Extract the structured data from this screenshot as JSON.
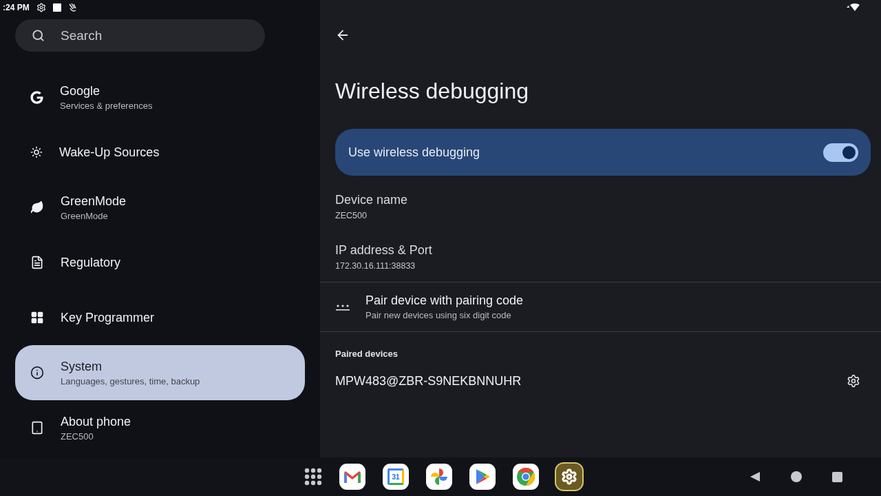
{
  "status_bar": {
    "time": ":24 PM"
  },
  "sidebar": {
    "search": {
      "placeholder": "Search"
    },
    "items": [
      {
        "kind": "google",
        "title": "Google",
        "subtitle": "Services & preferences",
        "selected": false
      },
      {
        "kind": "wake",
        "title": "Wake-Up Sources",
        "selected": false
      },
      {
        "kind": "leaf",
        "title": "GreenMode",
        "subtitle": "GreenMode",
        "selected": false
      },
      {
        "kind": "document",
        "title": "Regulatory",
        "selected": false
      },
      {
        "kind": "grid",
        "title": "Key Programmer",
        "selected": false
      },
      {
        "kind": "info",
        "title": "System",
        "subtitle": "Languages, gestures, time, backup",
        "selected": true
      },
      {
        "kind": "tablet",
        "title": "About phone",
        "subtitle": "ZEC500",
        "selected": false
      }
    ]
  },
  "detail": {
    "title": "Wireless debugging",
    "main_switch": {
      "label": "Use wireless debugging",
      "on": true
    },
    "info": [
      {
        "title": "Device name",
        "value": "ZEC500"
      },
      {
        "title": "IP address & Port",
        "value": "172.30.16.111:38833"
      }
    ],
    "pair": {
      "title": "Pair device with pairing code",
      "subtitle": "Pair new devices using six digit code"
    },
    "paired_header": "Paired devices",
    "paired_devices": [
      {
        "name": "MPW483@ZBR-S9NEKBNNUHR"
      }
    ]
  },
  "dock": {
    "apps": [
      {
        "kind": "gmail",
        "selected": false
      },
      {
        "kind": "calendar",
        "label": "31",
        "selected": false
      },
      {
        "kind": "photos",
        "selected": false
      },
      {
        "kind": "play",
        "selected": false
      },
      {
        "kind": "chrome",
        "selected": false
      },
      {
        "kind": "settings",
        "selected": true
      }
    ]
  }
}
